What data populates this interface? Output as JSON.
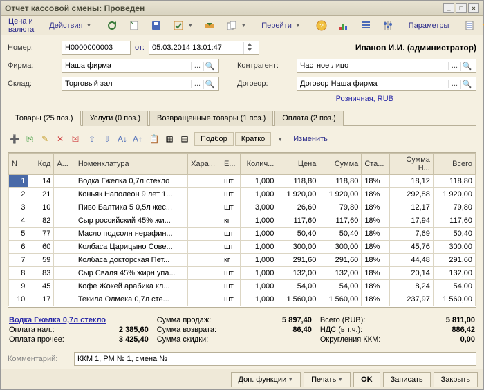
{
  "window": {
    "title": "Отчет кассовой смены: Проведен"
  },
  "toolbar": {
    "price_currency": "Цена и валюта",
    "actions": "Действия",
    "goto": "Перейти",
    "params": "Параметры"
  },
  "header": {
    "number_label": "Номер:",
    "number": "Н0000000003",
    "from_label": "от:",
    "date": "05.03.2014 13:01:47",
    "user": "Иванов И.И. (администратор)",
    "firm_label": "Фирма:",
    "firm": "Наша фирма",
    "contragent_label": "Контрагент:",
    "contragent": "Частное лицо",
    "warehouse_label": "Склад:",
    "warehouse": "Торговый зал",
    "contract_label": "Договор:",
    "contract": "Договор Наша фирма",
    "retail": "Розничная, RUB"
  },
  "tabs": {
    "goods": "Товары (25 поз.)",
    "services": "Услуги (0 поз.)",
    "returns": "Возвращенные товары (1 поз.)",
    "payment": "Оплата (2 поз.)"
  },
  "grid_toolbar": {
    "select": "Подбор",
    "short": "Кратко",
    "change": "Изменить"
  },
  "grid": {
    "columns": {
      "n": "N",
      "code": "Код",
      "a": "А...",
      "nomen": "Номенклатура",
      "char": "Хара...",
      "unit": "Е...",
      "qty": "Колич...",
      "price": "Цена",
      "sum": "Сумма",
      "rate": "Ста...",
      "vat": "Сумма Н...",
      "total": "Всего"
    },
    "rows": [
      {
        "n": "1",
        "code": "14",
        "nomen": "Водка Гжелка 0,7л стекло",
        "unit": "шт",
        "qty": "1,000",
        "price": "118,80",
        "sum": "118,80",
        "rate": "18%",
        "vat": "18,12",
        "total": "118,80"
      },
      {
        "n": "2",
        "code": "21",
        "nomen": "Коньяк Наполеон 9 лет 1...",
        "unit": "шт",
        "qty": "1,000",
        "price": "1 920,00",
        "sum": "1 920,00",
        "rate": "18%",
        "vat": "292,88",
        "total": "1 920,00"
      },
      {
        "n": "3",
        "code": "10",
        "nomen": "Пиво Балтика 5 0,5л жес...",
        "unit": "шт",
        "qty": "3,000",
        "price": "26,60",
        "sum": "79,80",
        "rate": "18%",
        "vat": "12,17",
        "total": "79,80"
      },
      {
        "n": "4",
        "code": "82",
        "nomen": "Сыр российский 45% жи...",
        "unit": "кг",
        "qty": "1,000",
        "price": "117,60",
        "sum": "117,60",
        "rate": "18%",
        "vat": "17,94",
        "total": "117,60"
      },
      {
        "n": "5",
        "code": "77",
        "nomen": "Масло подсолн нерафин...",
        "unit": "шт",
        "qty": "1,000",
        "price": "50,40",
        "sum": "50,40",
        "rate": "18%",
        "vat": "7,69",
        "total": "50,40"
      },
      {
        "n": "6",
        "code": "60",
        "nomen": "Колбаса Царицыно Сове...",
        "unit": "шт",
        "qty": "1,000",
        "price": "300,00",
        "sum": "300,00",
        "rate": "18%",
        "vat": "45,76",
        "total": "300,00"
      },
      {
        "n": "7",
        "code": "59",
        "nomen": "Колбаса докторская Пет...",
        "unit": "кг",
        "qty": "1,000",
        "price": "291,60",
        "sum": "291,60",
        "rate": "18%",
        "vat": "44,48",
        "total": "291,60"
      },
      {
        "n": "8",
        "code": "83",
        "nomen": "Сыр Сваля 45% жирн упа...",
        "unit": "шт",
        "qty": "1,000",
        "price": "132,00",
        "sum": "132,00",
        "rate": "18%",
        "vat": "20,14",
        "total": "132,00"
      },
      {
        "n": "9",
        "code": "45",
        "nomen": "Кофе Жокей арабика кл...",
        "unit": "шт",
        "qty": "1,000",
        "price": "54,00",
        "sum": "54,00",
        "rate": "18%",
        "vat": "8,24",
        "total": "54,00"
      },
      {
        "n": "10",
        "code": "17",
        "nomen": "Текила Олмека 0,7л сте...",
        "unit": "шт",
        "qty": "1,000",
        "price": "1 560,00",
        "sum": "1 560,00",
        "rate": "18%",
        "vat": "237,97",
        "total": "1 560,00"
      }
    ]
  },
  "summary": {
    "item_link": "Водка Гжелка 0,7л стекло",
    "cash_label": "Оплата нал.:",
    "cash": "2 385,60",
    "other_label": "Оплата прочее:",
    "other": "3 425,40",
    "sales_label": "Сумма продаж:",
    "sales": "5 897,40",
    "return_label": "Сумма возврата:",
    "return": "86,40",
    "discount_label": "Сумма скидки:",
    "discount": "",
    "total_label": "Всего (RUB):",
    "total": "5 811,00",
    "vat_label": "НДС (в т.ч.):",
    "vat": "886,42",
    "round_label": "Округления ККМ:",
    "round": "0,00"
  },
  "comment": {
    "label": "Комментарий:",
    "value": "ККМ 1, РМ № 1, смена №"
  },
  "footer": {
    "extra": "Доп. функции",
    "print": "Печать",
    "ok": "OK",
    "save": "Записать",
    "close": "Закрыть"
  }
}
